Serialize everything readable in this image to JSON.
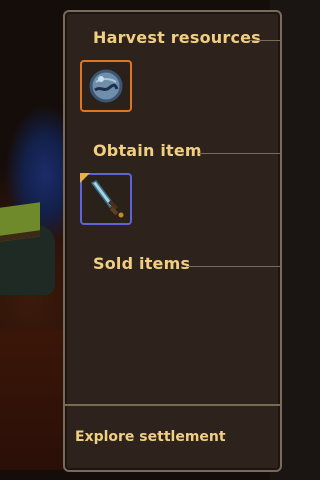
{
  "panel": {
    "sections": [
      {
        "title": "Harvest resources",
        "item_icon": "blue-stone-orb-icon",
        "item_rarity_color": "#e1741f"
      },
      {
        "title": "Obtain item",
        "item_icon": "crystal-sword-icon",
        "item_rarity_color": "#5d63d8"
      },
      {
        "title": "Sold items"
      }
    ],
    "footer": {
      "label": "Explore settlement"
    }
  },
  "colors": {
    "panel_bg": "#2e231c",
    "panel_border": "#7a6a58",
    "title_text": "#f1cf82"
  }
}
